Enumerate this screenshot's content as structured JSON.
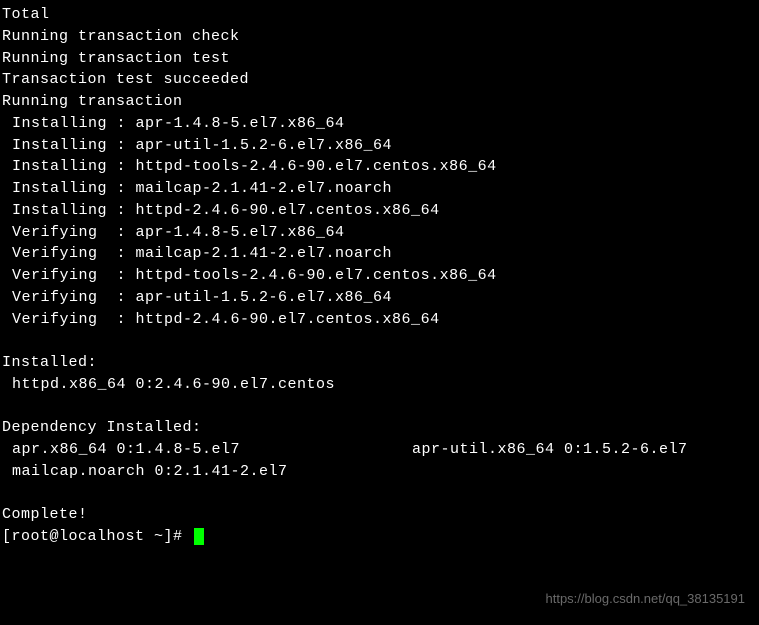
{
  "header": {
    "total": "Total",
    "check": "Running transaction check",
    "test": "Running transaction test",
    "succeeded": "Transaction test succeeded",
    "running": "Running transaction"
  },
  "actions": [
    "Installing : apr-1.4.8-5.el7.x86_64",
    "Installing : apr-util-1.5.2-6.el7.x86_64",
    "Installing : httpd-tools-2.4.6-90.el7.centos.x86_64",
    "Installing : mailcap-2.1.41-2.el7.noarch",
    "Installing : httpd-2.4.6-90.el7.centos.x86_64",
    "Verifying  : apr-1.4.8-5.el7.x86_64",
    "Verifying  : mailcap-2.1.41-2.el7.noarch",
    "Verifying  : httpd-tools-2.4.6-90.el7.centos.x86_64",
    "Verifying  : apr-util-1.5.2-6.el7.x86_64",
    "Verifying  : httpd-2.4.6-90.el7.centos.x86_64"
  ],
  "installed": {
    "heading": "Installed:",
    "pkg": "httpd.x86_64 0:2.4.6-90.el7.centos"
  },
  "dependency": {
    "heading": "Dependency Installed:",
    "row1_col1": "apr.x86_64 0:1.4.8-5.el7",
    "row1_col2": "apr-util.x86_64 0:1.5.2-6.el7",
    "row2": "mailcap.noarch 0:2.1.41-2.el7"
  },
  "complete": "Complete!",
  "prompt": "[root@localhost ~]# ",
  "watermark": "https://blog.csdn.net/qq_38135191"
}
